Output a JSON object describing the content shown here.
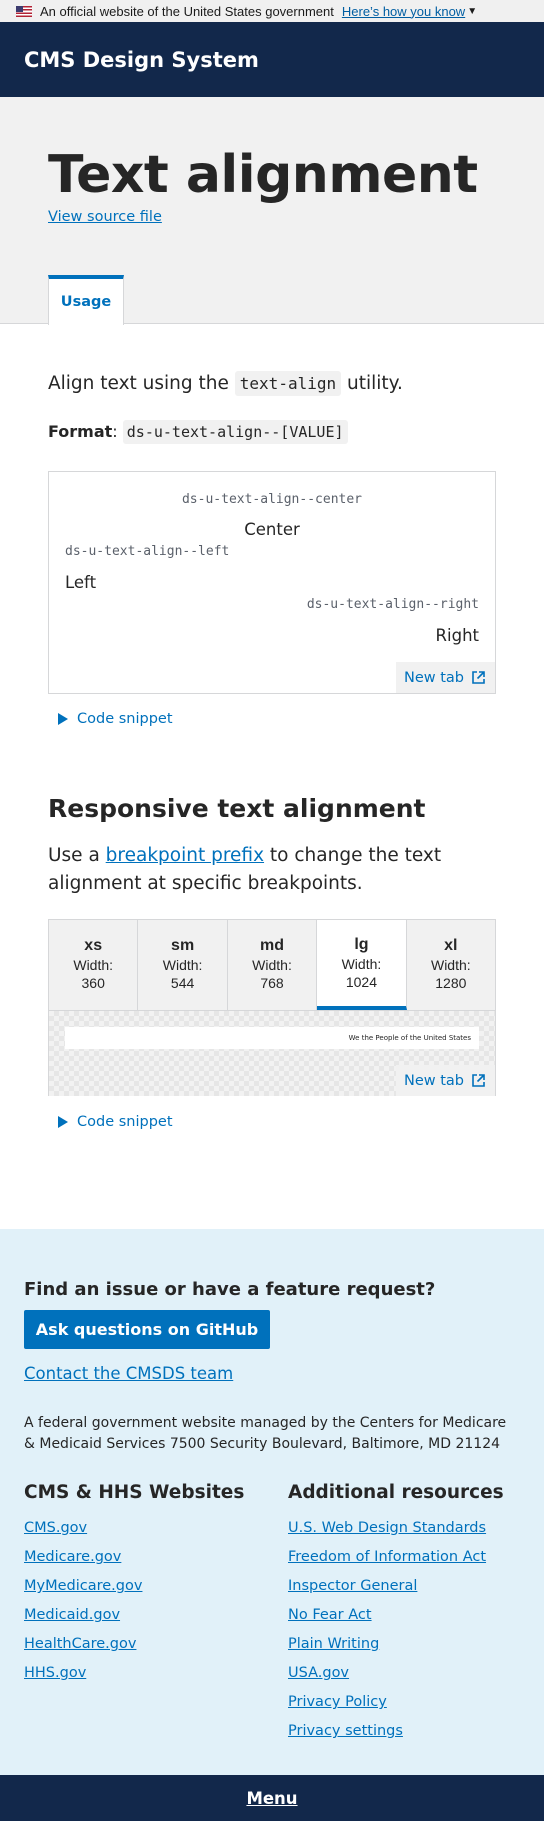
{
  "gov_banner": {
    "text": "An official website of the United States government",
    "link": "Here’s how you know"
  },
  "header": {
    "site_title": "CMS Design System"
  },
  "hero": {
    "title": "Text alignment",
    "source_link": "View source file",
    "tabs": [
      {
        "label": "Usage"
      }
    ]
  },
  "intro": {
    "before": "Align text using the ",
    "code": "text-align",
    "after": " utility."
  },
  "format": {
    "label": "Format",
    "colon": ": ",
    "code": "ds-u-text-align--[VALUE]"
  },
  "example1": {
    "items": [
      {
        "class": "ds-u-text-align--center",
        "text": "Center"
      },
      {
        "class": "ds-u-text-align--left",
        "text": "Left"
      },
      {
        "class": "ds-u-text-align--right",
        "text": "Right"
      }
    ],
    "new_tab": "New tab",
    "snippet": "Code snippet"
  },
  "responsive": {
    "heading": "Responsive text alignment",
    "text_before": "Use a ",
    "link": "breakpoint prefix",
    "text_after": " to change the text alignment at specific breakpoints.",
    "width_label": "Width:",
    "breakpoints": [
      {
        "name": "xs",
        "width": "360"
      },
      {
        "name": "sm",
        "width": "544"
      },
      {
        "name": "md",
        "width": "768"
      },
      {
        "name": "lg",
        "width": "1024"
      },
      {
        "name": "xl",
        "width": "1280"
      }
    ],
    "active_breakpoint": "lg",
    "preview_text": "We the People of the United States",
    "new_tab": "New tab",
    "snippet": "Code snippet"
  },
  "footer": {
    "heading": "Find an issue or have a feature request?",
    "github_button": "Ask questions on GitHub",
    "contact_link": "Contact the CMSDS team",
    "about": "A federal government website managed by the Centers for Medicare & Medicaid Services 7500 Security Boulevard, Baltimore, MD 21124",
    "col1": {
      "heading": "CMS & HHS Websites",
      "links": [
        "CMS.gov",
        "Medicare.gov",
        "MyMedicare.gov",
        "Medicaid.gov",
        "HealthCare.gov",
        "HHS.gov"
      ]
    },
    "col2": {
      "heading": "Additional resources",
      "links": [
        "U.S. Web Design Standards",
        "Freedom of Information Act",
        "Inspector General",
        "No Fear Act",
        "Plain Writing",
        "USA.gov",
        "Privacy Policy",
        "Privacy settings"
      ]
    }
  },
  "menu": {
    "label": "Menu"
  },
  "colors": {
    "header_bg": "#12284b",
    "primary": "#0071bc",
    "hero_bg": "#f1f1f1",
    "footer_bg": "#e1f1f9"
  }
}
